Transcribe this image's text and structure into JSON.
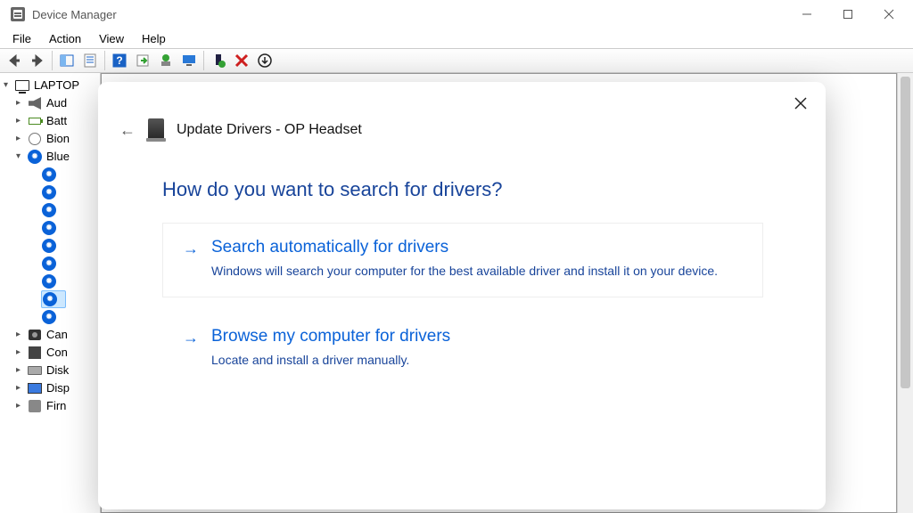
{
  "window": {
    "title": "Device Manager"
  },
  "menu": {
    "file": "File",
    "action": "Action",
    "view": "View",
    "help": "Help"
  },
  "tree": {
    "root": "LAPTOP",
    "items": [
      {
        "label": "Aud",
        "icon": "speaker"
      },
      {
        "label": "Batt",
        "icon": "battery"
      },
      {
        "label": "Bion",
        "icon": "finger"
      },
      {
        "label": "Blue",
        "icon": "bluetooth",
        "expanded": true
      }
    ],
    "bt_count": 9,
    "bt_selected_index": 7,
    "tail": [
      {
        "label": "Can",
        "icon": "camera"
      },
      {
        "label": "Con",
        "icon": "chip"
      },
      {
        "label": "Disk",
        "icon": "disk"
      },
      {
        "label": "Disp",
        "icon": "display"
      },
      {
        "label": "Firn",
        "icon": "generic"
      }
    ]
  },
  "dialog": {
    "title": "Update Drivers - OP Headset",
    "heading": "How do you want to search for drivers?",
    "option1": {
      "title": "Search automatically for drivers",
      "desc": "Windows will search your computer for the best available driver and install it on your device."
    },
    "option2": {
      "title": "Browse my computer for drivers",
      "desc": "Locate and install a driver manually."
    }
  }
}
